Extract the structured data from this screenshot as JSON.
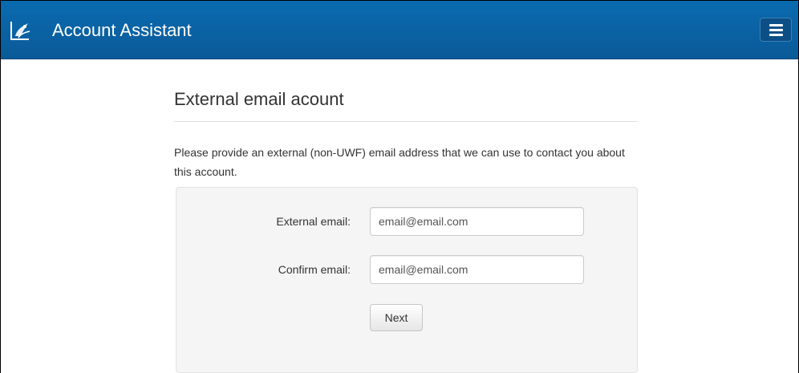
{
  "header": {
    "app_title": "Account Assistant",
    "logo_icon": "uwf-argo-logo-icon",
    "menu_icon": "hamburger-menu-icon",
    "bar_color": "#0a6bb0"
  },
  "page": {
    "heading": "External email acount",
    "intro": "Please provide an external (non-UWF) email address that we can use to contact you about this account."
  },
  "form": {
    "external_email": {
      "label": "External email:",
      "placeholder": "email@email.com",
      "value": ""
    },
    "confirm_email": {
      "label": "Confirm email:",
      "placeholder": "email@email.com",
      "value": ""
    },
    "next_label": "Next"
  }
}
